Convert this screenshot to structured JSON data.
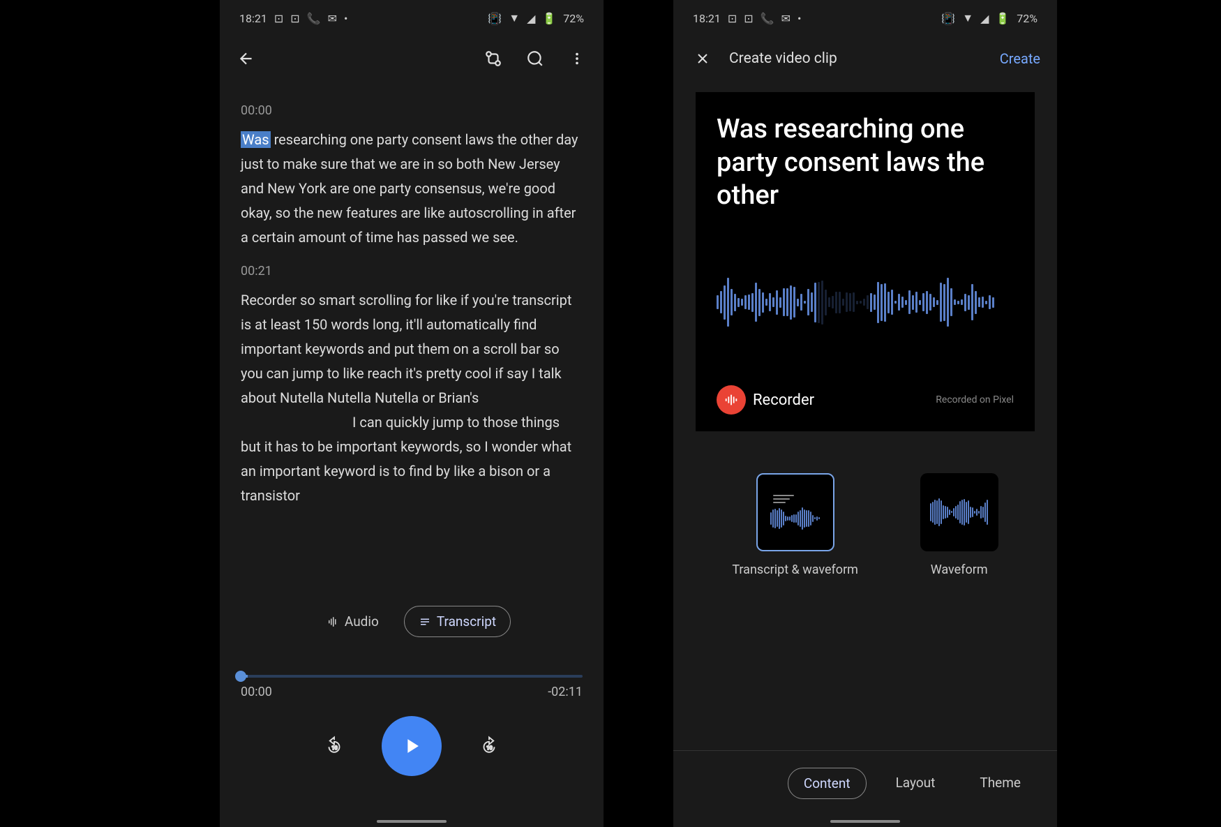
{
  "status": {
    "time": "18:21",
    "battery": "72%"
  },
  "phone1": {
    "transcript": [
      {
        "ts": "00:00",
        "highlighted": "Was",
        "rest": " researching one party consent laws the other day just to make sure that we are in so both New Jersey and New York are one party consensus, we're good okay, so the new features are like autoscrolling in after a certain amount of time has passed we see."
      },
      {
        "ts": "00:21",
        "text_a": "Recorder so smart scrolling for like if you're transcript is at least 150 words long, it'll automatically find important keywords and put them on a scroll bar so you can jump to like reach it's pretty cool if say I talk about Nutella Nutella Nutella or Brian's",
        "text_b": "I can quickly jump to those things but it has to be important keywords, so I wonder what an important keyword is to find by like a bison or a transistor"
      }
    ],
    "toggle": {
      "audio": "Audio",
      "transcript": "Transcript"
    },
    "time_current": "00:00",
    "time_remaining": "-02:11"
  },
  "phone2": {
    "title": "Create video clip",
    "create": "Create",
    "preview_text": "Was researching one party consent laws the other",
    "recorder_label": "Recorder",
    "recorded_on": "Recorded on Pixel",
    "options": {
      "transcript_waveform": "Transcript & waveform",
      "waveform": "Waveform"
    },
    "tabs": {
      "content": "Content",
      "layout": "Layout",
      "theme": "Theme"
    }
  }
}
